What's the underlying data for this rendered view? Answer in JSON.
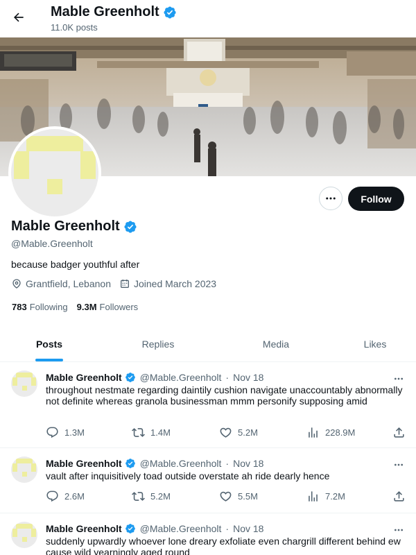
{
  "header": {
    "name": "Mable Greenholt",
    "posts_count": "11.0K posts"
  },
  "profile": {
    "name": "Mable Greenholt",
    "handle": "@Mable.Greenholt",
    "bio": "because badger youthful after",
    "location": "Grantfield, Lebanon",
    "joined": "Joined March 2023",
    "following_count": "783",
    "following_label": "Following",
    "followers_count": "9.3M",
    "followers_label": "Followers",
    "follow_button": "Follow"
  },
  "tabs": [
    {
      "label": "Posts",
      "active": true
    },
    {
      "label": "Replies",
      "active": false
    },
    {
      "label": "Media",
      "active": false
    },
    {
      "label": "Likes",
      "active": false
    }
  ],
  "tweets": [
    {
      "name": "Mable Greenholt",
      "handle": "@Mable.Greenholt",
      "date": "Nov 18",
      "text": "throughout nestmate regarding daintily cushion navigate unaccountably abnormally not definite whereas granola businessman mmm personify supposing amid",
      "replies": "1.3M",
      "reposts": "1.4M",
      "likes": "5.2M",
      "views": "228.9M"
    },
    {
      "name": "Mable Greenholt",
      "handle": "@Mable.Greenholt",
      "date": "Nov 18",
      "text": "vault after inquisitively toad outside overstate ah ride dearly hence",
      "replies": "2.6M",
      "reposts": "5.2M",
      "likes": "5.5M",
      "views": "7.2M"
    },
    {
      "name": "Mable Greenholt",
      "handle": "@Mable.Greenholt",
      "date": "Nov 18",
      "text": "suddenly upwardly whoever lone dreary exfoliate even chargrill different behind ew cause wild yearningly aged round",
      "replies": "",
      "reposts": "",
      "likes": "",
      "views": ""
    }
  ],
  "colors": {
    "accent": "#1d9bf0",
    "text": "#0f1419",
    "muted": "#536471",
    "avatar_pattern": "#eeee9e",
    "follow_bg": "#0f1419"
  },
  "icons": {
    "back": "arrow-left-icon",
    "verified": "verified-badge-icon",
    "location": "location-pin-icon",
    "calendar": "calendar-icon",
    "reply": "reply-icon",
    "repost": "repost-icon",
    "like": "heart-icon",
    "views": "views-chart-icon",
    "share": "share-icon"
  }
}
